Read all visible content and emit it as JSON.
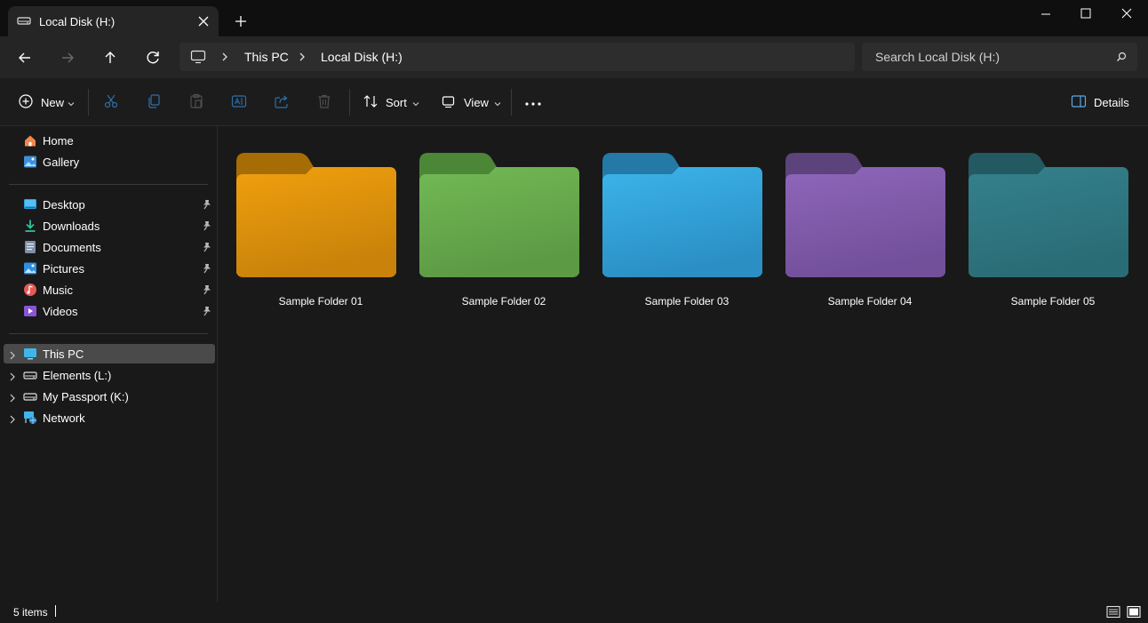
{
  "tab": {
    "title": "Local Disk (H:)"
  },
  "breadcrumb": [
    "This PC",
    "Local Disk (H:)"
  ],
  "search": {
    "placeholder": "Search Local Disk (H:)"
  },
  "toolbar": {
    "new": "New",
    "sort": "Sort",
    "view": "View",
    "details": "Details"
  },
  "sidebar": {
    "quick": [
      {
        "label": "Home",
        "icon": "home-icon"
      },
      {
        "label": "Gallery",
        "icon": "gallery-icon"
      }
    ],
    "pinned": [
      {
        "label": "Desktop",
        "icon": "desktop-icon"
      },
      {
        "label": "Downloads",
        "icon": "download-icon"
      },
      {
        "label": "Documents",
        "icon": "documents-icon"
      },
      {
        "label": "Pictures",
        "icon": "pictures-icon"
      },
      {
        "label": "Music",
        "icon": "music-icon"
      },
      {
        "label": "Videos",
        "icon": "videos-icon"
      }
    ],
    "drives": [
      {
        "label": "This PC",
        "icon": "monitor-icon",
        "selected": true
      },
      {
        "label": "Elements (L:)",
        "icon": "drive-icon"
      },
      {
        "label": "My Passport (K:)",
        "icon": "drive-icon"
      },
      {
        "label": "Network",
        "icon": "network-icon"
      }
    ]
  },
  "folders": [
    {
      "name": "Sample Folder 01",
      "back": "#a66c06",
      "front": "#f0a00e",
      "frontDark": "#c9820a"
    },
    {
      "name": "Sample Folder 02",
      "back": "#4c8637",
      "front": "#72b955",
      "frontDark": "#5c9a44"
    },
    {
      "name": "Sample Folder 03",
      "back": "#2479a6",
      "front": "#3bb4ea",
      "frontDark": "#2b8fc4"
    },
    {
      "name": "Sample Folder 04",
      "back": "#5c437b",
      "front": "#8f66bb",
      "frontDark": "#73509a"
    },
    {
      "name": "Sample Folder 05",
      "back": "#235a62",
      "front": "#34818c",
      "frontDark": "#2a6c76"
    }
  ],
  "status": {
    "count": "5 items"
  }
}
